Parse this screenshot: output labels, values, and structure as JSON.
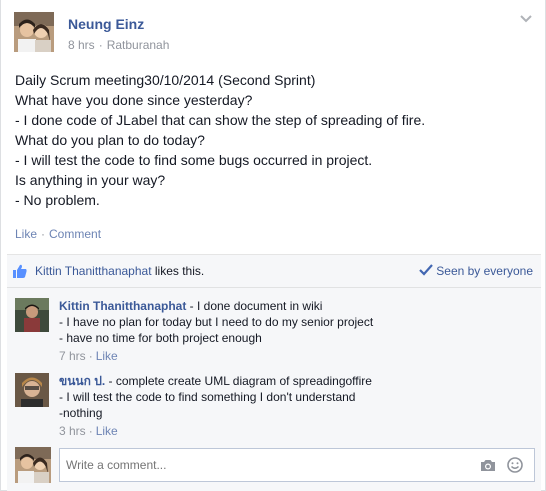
{
  "post": {
    "author": "Neung Einz",
    "time": "8 hrs",
    "dot": "·",
    "location": "Ratburanah",
    "lines": [
      "Daily Scrum meeting30/10/2014 (Second Sprint)",
      "What have you done since yesterday?",
      "- I done code of JLabel that can show the step of spreading of fire.",
      "What do you plan to do today?",
      "- I will test the code to find some bugs occurred in project.",
      "Is anything in your way?",
      "- No problem."
    ],
    "like_label": "Like",
    "sep": "·",
    "comment_label": "Comment"
  },
  "likes": {
    "liker": "Kittin Thanitthanaphat",
    "suffix": " likes this.",
    "seen_label": "Seen by everyone"
  },
  "comments": [
    {
      "author": "Kittin Thanitthanaphat",
      "first_line": " - I done document in wiki",
      "lines": [
        "- I have no plan for today but I need to do my senior project",
        "- have no time for both project enough"
      ],
      "time": "7 hrs",
      "sep": "·",
      "like_label": "Like"
    },
    {
      "author": "ขนนก ป.",
      "first_line": " - complete create UML diagram of spreadingoffire",
      "lines": [
        "- I will test the code to find something I don't understand",
        "-nothing"
      ],
      "time": "3 hrs",
      "sep": "·",
      "like_label": "Like"
    }
  ],
  "composer": {
    "placeholder": "Write a comment..."
  },
  "colors": {
    "link": "#3b5998",
    "action": "#6d84b4",
    "meta": "#90949c"
  }
}
